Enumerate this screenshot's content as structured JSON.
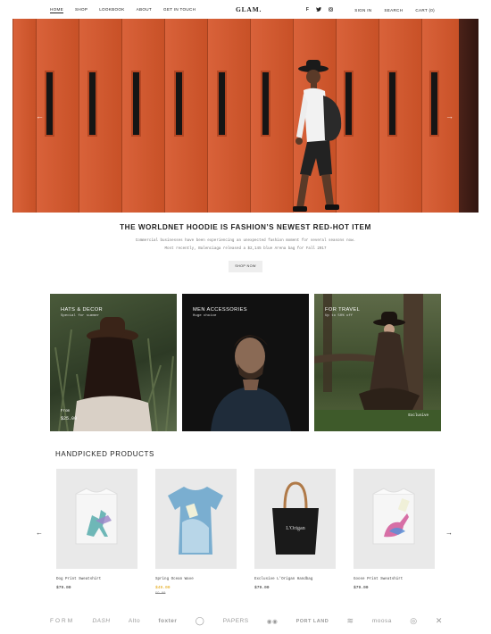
{
  "nav": {
    "left": [
      "HOME",
      "SHOP",
      "LOOKBOOK",
      "ABOUT",
      "GET IN TOUCH"
    ],
    "logo": "GLAM.",
    "social": [
      "f",
      "t",
      "o"
    ],
    "right": [
      "SIGN IN",
      "SEARCH",
      "CART (0)"
    ]
  },
  "hero": {
    "prev_icon": "chevron-left-icon",
    "next_icon": "chevron-right-icon"
  },
  "feature": {
    "headline": "THE WORLDNET HOODIE IS FASHION’S NEWEST RED-HOT ITEM",
    "sub_line1": "Commercial businesses have been experiencing an unexpected fashion moment for several seasons now.",
    "sub_line2": "Most recently, Balenciaga released a $2,145 blue Arena bag for Fall 2017",
    "button": "SHOP NOW"
  },
  "categories": [
    {
      "title": "HATS & DECOR",
      "subtitle": "Special for summer",
      "corner_label": "From",
      "corner_price": "$25.00"
    },
    {
      "title": "MEN ACCESSORIES",
      "subtitle": "Huge choice",
      "corner_label": "",
      "corner_price": ""
    },
    {
      "title": "FOR TRAVEL",
      "subtitle": "Up to 50% off",
      "corner_label": "",
      "corner_price": "Exclusive"
    }
  ],
  "products_section": {
    "title": "HANDPICKED PRODUCTS",
    "items": [
      {
        "name": "Dog Print Sweatshirt",
        "price": "$79.00",
        "old_price": ""
      },
      {
        "name": "Spring Ocean Wave",
        "price": "$49.00",
        "old_price": "59.00"
      },
      {
        "name": "Exclusive L'Origan Handbag",
        "price": "$79.00",
        "old_price": ""
      },
      {
        "name": "Goose Print Sweatshirt",
        "price": "$79.00",
        "old_price": ""
      }
    ]
  },
  "brand_logos": [
    "FORM",
    "DASH",
    "Alto",
    "foxter",
    "◯",
    "PAPERS",
    "◉◉",
    "PORT LAND",
    "≋",
    "moosa",
    "◎",
    "✕"
  ],
  "colors": {
    "accent": "#e2a000",
    "hero": "#d85a31"
  }
}
